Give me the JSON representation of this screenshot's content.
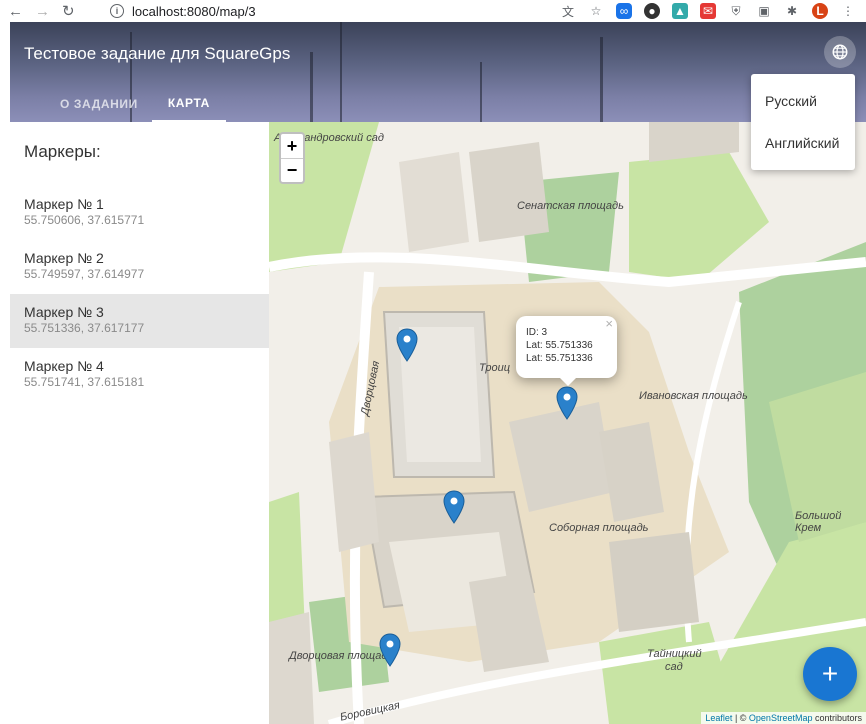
{
  "browser": {
    "url": "localhost:8080/map/3"
  },
  "header": {
    "title": "Тестовое задание для SquareGps",
    "tabs": [
      {
        "label": "О ЗАДАНИИ"
      },
      {
        "label": "КАРТА"
      }
    ]
  },
  "language_menu": {
    "items": [
      "Русский",
      "Английский"
    ]
  },
  "sidebar": {
    "title": "Маркеры:",
    "markers": [
      {
        "name": "Маркер № 1",
        "coords": "55.750606, 37.615771"
      },
      {
        "name": "Маркер № 2",
        "coords": "55.749597, 37.614977"
      },
      {
        "name": "Маркер № 3",
        "coords": "55.751336, 37.617177"
      },
      {
        "name": "Маркер № 4",
        "coords": "55.751741, 37.615181"
      }
    ]
  },
  "map": {
    "zoom_in": "+",
    "zoom_out": "−",
    "popup": {
      "close": "×",
      "id_line": "ID: 3",
      "lat_line_1": "Lat: 55.751336",
      "lat_line_2": "Lat: 55.751336"
    },
    "labels": {
      "garden": "Александровский сад",
      "senate": "Сенатская площадь",
      "troitskaya": "Троиц",
      "ivanovskaya": "Ивановская площадь",
      "dvortsovaya": "Дворцовая",
      "sobornaya": "Соборная площадь",
      "bolshoy": "Большой Крем",
      "dvortsovaya_sq": "Дворцовая площадь",
      "taynitsky_1": "Тайницкий",
      "taynitsky_2": "сад",
      "borovitskaya": "Боровицкая"
    },
    "attribution": {
      "leaflet": "Leaflet",
      "sep": " | © ",
      "osm": "OpenStreetMap",
      "contributors": " contributors"
    },
    "marker_color": "#2a81cb"
  },
  "fab": {
    "label": "+"
  }
}
